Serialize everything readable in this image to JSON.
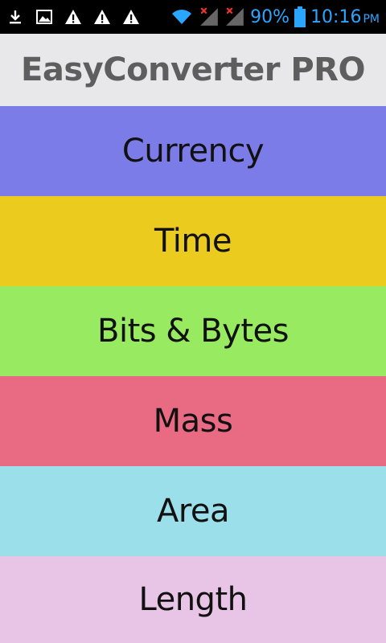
{
  "status_bar": {
    "battery": "90%",
    "time": "10:16",
    "ampm": "PM",
    "icons": [
      "download-icon",
      "image-icon",
      "warning-icon",
      "warning-icon",
      "warning-icon",
      "wifi-icon",
      "signal-icon",
      "signal-icon",
      "battery-icon"
    ],
    "accent_color": "#2aa6ff"
  },
  "app_bar": {
    "title": "EasyConverter PRO",
    "background": "#e8e8ea"
  },
  "menu": {
    "items": [
      {
        "label": "Currency",
        "color": "#7c7ce9"
      },
      {
        "label": "Time",
        "color": "#eccb1f"
      },
      {
        "label": "Bits & Bytes",
        "color": "#98ea61"
      },
      {
        "label": "Mass",
        "color": "#e96a83"
      },
      {
        "label": "Area",
        "color": "#9adfea"
      },
      {
        "label": "Length",
        "color": "#e8c4e6"
      }
    ]
  }
}
